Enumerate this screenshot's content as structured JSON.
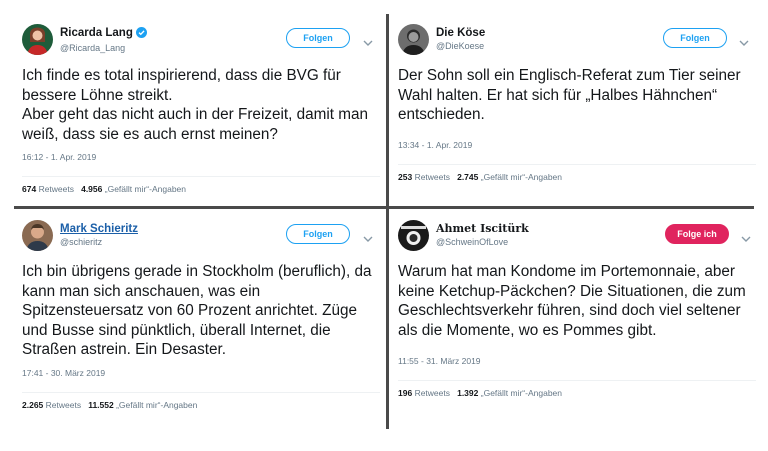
{
  "tweets": [
    {
      "display_name": "Ricarda Lang",
      "handle": "@Ricarda_Lang",
      "verified": true,
      "follow_label": "Folgen",
      "text": "Ich finde es total inspirierend, dass die BVG für bessere Löhne streikt.\nAber geht das nicht auch in der Freizeit, damit man weiß, dass sie es auch ernst meinen?",
      "timestamp": "16:12 - 1. Apr. 2019",
      "retweets_count": "674",
      "retweets_label": "Retweets",
      "likes_count": "4.956",
      "likes_label": "„Gefällt mir“-Angaben"
    },
    {
      "display_name": "Die Köse",
      "handle": "@DieKoese",
      "verified": false,
      "follow_label": "Folgen",
      "text": "Der Sohn soll ein Englisch-Referat zum Tier seiner Wahl halten. Er hat sich für „Halbes Hähnchen“ entschieden.",
      "timestamp": "13:34 - 1. Apr. 2019",
      "retweets_count": "253",
      "retweets_label": "Retweets",
      "likes_count": "2.745",
      "likes_label": "„Gefällt mir“-Angaben"
    },
    {
      "display_name": "Mark Schieritz",
      "handle": "@schieritz",
      "verified": false,
      "follow_label": "Folgen",
      "text": "Ich bin übrigens gerade in Stockholm (beruflich), da kann man sich anschauen, was ein Spitzensteuersatz von 60 Prozent anrichtet. Züge und Busse sind pünktlich, überall Internet, die Straßen astrein.  Ein Desaster.",
      "timestamp": "17:41 - 30. März 2019",
      "retweets_count": "2.265",
      "retweets_label": "Retweets",
      "likes_count": "11.552",
      "likes_label": "„Gefällt mir“-Angaben"
    },
    {
      "display_name": "Ahmet Iscitürk",
      "handle": "@SchweinOfLove",
      "verified": false,
      "follow_label": "Folge ich",
      "text": "Warum hat man Kondome im Portemonnaie, aber keine Ketchup-Päckchen? Die Situationen, die zum Geschlechtsverkehr führen, sind doch viel seltener als die Momente, wo es Pommes gibt.",
      "timestamp": "11:55 - 31. März 2019",
      "retweets_count": "196",
      "retweets_label": "Retweets",
      "likes_count": "1.392",
      "likes_label": "„Gefällt mir“-Angaben"
    }
  ],
  "colors": {
    "accent": "#1da1f2",
    "following": "#e0245e",
    "divider": "#4a4a4a",
    "muted_text": "#657786"
  },
  "icons": [
    "verified-badge-icon",
    "chevron-down-icon"
  ]
}
